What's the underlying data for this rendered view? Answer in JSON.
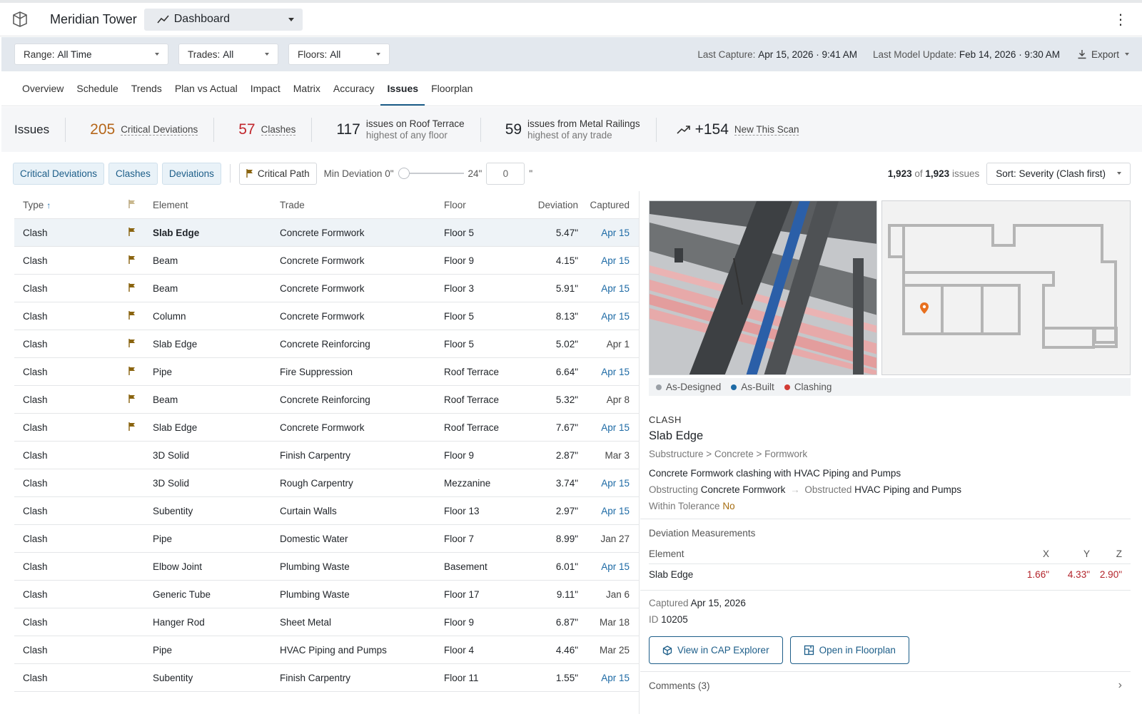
{
  "header": {
    "project": "Meridian Tower",
    "view": "Dashboard"
  },
  "filters": {
    "range": {
      "label": "Range:",
      "value": "All Time"
    },
    "trades": {
      "label": "Trades:",
      "value": "All"
    },
    "floors": {
      "label": "Floors:",
      "value": "All"
    },
    "last_capture_label": "Last Capture:",
    "last_capture": "Apr 15, 2026 · 9:41 AM",
    "last_model_label": "Last Model Update:",
    "last_model": "Feb 14, 2026 · 9:30 AM",
    "export": "Export"
  },
  "tabs": [
    "Overview",
    "Schedule",
    "Trends",
    "Plan vs Actual",
    "Impact",
    "Matrix",
    "Accuracy",
    "Issues",
    "Floorplan"
  ],
  "active_tab": "Issues",
  "summary": {
    "title": "Issues",
    "critical_num": "205",
    "critical_label": "Critical Deviations",
    "clashes_num": "57",
    "clashes_label": "Clashes",
    "floor_num": "117",
    "floor_line1": "issues on Roof Terrace",
    "floor_line2": "highest of any floor",
    "trade_num": "59",
    "trade_line1": "issues from Metal Railings",
    "trade_line2": "highest of any trade",
    "new_num": "+154",
    "new_label": "New This Scan"
  },
  "controls": {
    "chips": [
      "Critical Deviations",
      "Clashes",
      "Deviations"
    ],
    "critical_path": "Critical Path",
    "min_dev_label": "Min Deviation",
    "min_dev_low": "0\"",
    "min_dev_high": "24\"",
    "min_dev_value": "0",
    "min_dev_unit": "\"",
    "shown": "1,923",
    "of": "of",
    "total": "1,923",
    "issues_word": "issues",
    "sort": "Sort: Severity (Clash first)"
  },
  "table": {
    "columns": {
      "type": "Type",
      "element": "Element",
      "trade": "Trade",
      "floor": "Floor",
      "deviation": "Deviation",
      "captured": "Captured"
    },
    "rows": [
      {
        "type": "Clash",
        "flag": true,
        "element": "Slab Edge",
        "trade": "Concrete Formwork",
        "floor": "Floor 5",
        "deviation": "5.47\"",
        "captured": "Apr 15",
        "new": true
      },
      {
        "type": "Clash",
        "flag": true,
        "element": "Beam",
        "trade": "Concrete Formwork",
        "floor": "Floor 9",
        "deviation": "4.15\"",
        "captured": "Apr 15",
        "new": true
      },
      {
        "type": "Clash",
        "flag": true,
        "element": "Beam",
        "trade": "Concrete Formwork",
        "floor": "Floor 3",
        "deviation": "5.91\"",
        "captured": "Apr 15",
        "new": true
      },
      {
        "type": "Clash",
        "flag": true,
        "element": "Column",
        "trade": "Concrete Formwork",
        "floor": "Floor 5",
        "deviation": "8.13\"",
        "captured": "Apr 15",
        "new": true
      },
      {
        "type": "Clash",
        "flag": true,
        "element": "Slab Edge",
        "trade": "Concrete Reinforcing",
        "floor": "Floor 5",
        "deviation": "5.02\"",
        "captured": "Apr 1",
        "new": false
      },
      {
        "type": "Clash",
        "flag": true,
        "element": "Pipe",
        "trade": "Fire Suppression",
        "floor": "Roof Terrace",
        "deviation": "6.64\"",
        "captured": "Apr 15",
        "new": true
      },
      {
        "type": "Clash",
        "flag": true,
        "element": "Beam",
        "trade": "Concrete Reinforcing",
        "floor": "Roof Terrace",
        "deviation": "5.32\"",
        "captured": "Apr 8",
        "new": false
      },
      {
        "type": "Clash",
        "flag": true,
        "element": "Slab Edge",
        "trade": "Concrete Formwork",
        "floor": "Roof Terrace",
        "deviation": "7.67\"",
        "captured": "Apr 15",
        "new": true
      },
      {
        "type": "Clash",
        "flag": false,
        "element": "3D Solid",
        "trade": "Finish Carpentry",
        "floor": "Floor 9",
        "deviation": "2.87\"",
        "captured": "Mar 3",
        "new": false
      },
      {
        "type": "Clash",
        "flag": false,
        "element": "3D Solid",
        "trade": "Rough Carpentry",
        "floor": "Mezzanine",
        "deviation": "3.74\"",
        "captured": "Apr 15",
        "new": true
      },
      {
        "type": "Clash",
        "flag": false,
        "element": "Subentity",
        "trade": "Curtain Walls",
        "floor": "Floor 13",
        "deviation": "2.97\"",
        "captured": "Apr 15",
        "new": true
      },
      {
        "type": "Clash",
        "flag": false,
        "element": "Pipe",
        "trade": "Domestic Water",
        "floor": "Floor 7",
        "deviation": "8.99\"",
        "captured": "Jan 27",
        "new": false
      },
      {
        "type": "Clash",
        "flag": false,
        "element": "Elbow Joint",
        "trade": "Plumbing Waste",
        "floor": "Basement",
        "deviation": "6.01\"",
        "captured": "Apr 15",
        "new": true
      },
      {
        "type": "Clash",
        "flag": false,
        "element": "Generic Tube",
        "trade": "Plumbing Waste",
        "floor": "Floor 17",
        "deviation": "9.11\"",
        "captured": "Jan 6",
        "new": false
      },
      {
        "type": "Clash",
        "flag": false,
        "element": "Hanger Rod",
        "trade": "Sheet Metal",
        "floor": "Floor 9",
        "deviation": "6.87\"",
        "captured": "Mar 18",
        "new": false
      },
      {
        "type": "Clash",
        "flag": false,
        "element": "Pipe",
        "trade": "HVAC Piping and Pumps",
        "floor": "Floor 4",
        "deviation": "4.46\"",
        "captured": "Mar 25",
        "new": false
      },
      {
        "type": "Clash",
        "flag": false,
        "element": "Subentity",
        "trade": "Finish Carpentry",
        "floor": "Floor 11",
        "deviation": "1.55\"",
        "captured": "Apr 15",
        "new": true
      }
    ]
  },
  "detail": {
    "legend": [
      {
        "label": "As-Designed",
        "color": "#9aa0a6"
      },
      {
        "label": "As-Built",
        "color": "#1d6aa5"
      },
      {
        "label": "Clashing",
        "color": "#d23b34"
      }
    ],
    "kind": "CLASH",
    "title": "Slab Edge",
    "crumb": "Substructure > Concrete > Formwork",
    "desc": "Concrete Formwork clashing with HVAC Piping and Pumps",
    "obstructing_label": "Obstructing",
    "obstructing": "Concrete Formwork",
    "obstructed_label": "Obstructed",
    "obstructed": "HVAC Piping and Pumps",
    "tolerance_label": "Within Tolerance",
    "tolerance": "No",
    "measurements_title": "Deviation Measurements",
    "meas_head": {
      "element": "Element",
      "x": "X",
      "y": "Y",
      "z": "Z"
    },
    "meas_row": {
      "element": "Slab Edge",
      "x": "1.66\"",
      "y": "4.33\"",
      "z": "2.90\""
    },
    "captured_label": "Captured",
    "captured": "Apr 15, 2026",
    "id_label": "ID",
    "id": "10205",
    "btn_cap": "View in CAP Explorer",
    "btn_floorplan": "Open in Floorplan",
    "comments": "Comments (3)"
  },
  "colors": {
    "accent": "#1d5e89",
    "flag": "#8a6410",
    "critical": "#b5661a",
    "clash": "#c1272d"
  }
}
